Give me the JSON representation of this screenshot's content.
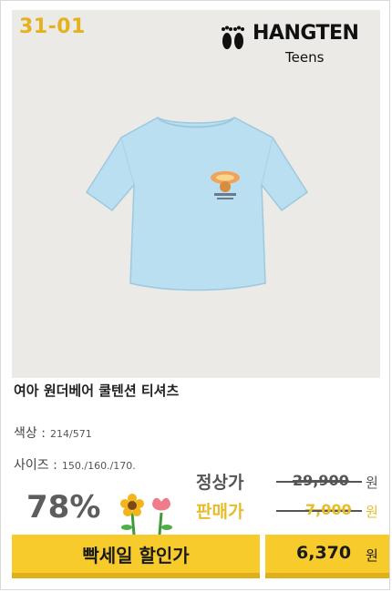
{
  "badge_code": "31-01",
  "brand": {
    "name": "HANGTEN",
    "sub": "Teens"
  },
  "product": {
    "title": "여아 원더베어 쿨텐션 티셔츠",
    "color_label": "색상 :",
    "color_value": "214/571",
    "size_label": "사이즈 :",
    "size_value": "150./160./170."
  },
  "pricing": {
    "discount": "78%",
    "regular_label": "정상가",
    "regular_price": "29,900",
    "list_label": "판매가",
    "list_price": "7,000",
    "currency": "원",
    "sale_label": "빡세일 할인가",
    "sale_price": "6,370",
    "sale_currency": "원"
  },
  "colors": {
    "accent_yellow": "#f7cb2c",
    "badge_yellow": "#e3b21d",
    "shirt_blue": "#b9dff0",
    "list_price_yellow": "#e6bc2c"
  }
}
